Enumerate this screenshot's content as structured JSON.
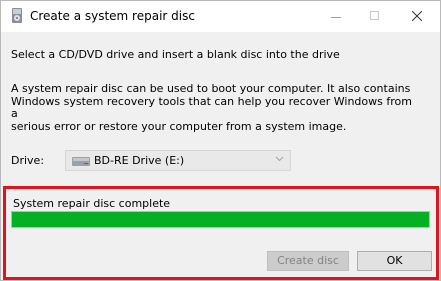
{
  "window": {
    "title": "Create a system repair disc"
  },
  "titlebar": {
    "minimize_icon": "minimize-icon",
    "maximize_icon": "maximize-icon",
    "close_icon": "close-icon"
  },
  "main": {
    "instruction": "Select a CD/DVD drive and insert a blank disc into the drive",
    "description_lines": [
      "A system repair disc can be used to boot your computer. It also contains",
      "Windows system recovery tools that can help you recover Windows from a",
      "serious error or restore your computer from a system image."
    ],
    "drive_label": "Drive:",
    "drive_value": "BD-RE Drive (E:)"
  },
  "progress": {
    "status": "System repair disc complete",
    "fraction": 1.0,
    "color": "#06b025"
  },
  "buttons": {
    "create_label": "Create disc",
    "ok_label": "OK"
  },
  "colors": {
    "highlight": "#e0141c"
  }
}
